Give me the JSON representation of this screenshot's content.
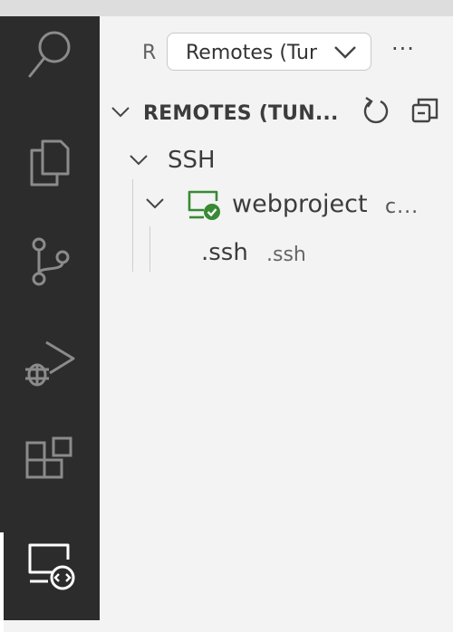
{
  "activity_bar": {
    "items": [
      {
        "icon": "search-icon"
      },
      {
        "icon": "files-icon"
      },
      {
        "icon": "source-control-icon"
      },
      {
        "icon": "run-debug-icon"
      },
      {
        "icon": "extensions-icon"
      },
      {
        "icon": "remote-explorer-icon",
        "active": true
      }
    ]
  },
  "sidebar": {
    "header_letter": "R",
    "dropdown_value": "Remotes (Tunnels/SSH)",
    "more_label": "···",
    "section": {
      "title": "REMOTES (TUN...",
      "refresh_icon": "refresh-icon",
      "collapse_icon": "collapse-all-icon"
    },
    "tree": {
      "group_label": "SSH",
      "host": {
        "label": "webproject",
        "description": "c...",
        "status_icon": "remote-connected-icon",
        "status_color": "#388a34"
      },
      "folder": {
        "label": ".ssh",
        "description": ".ssh"
      }
    }
  },
  "colors": {
    "activity_bg": "#2c2c2c",
    "sidebar_bg": "#f3f3f3",
    "accent_green": "#388a34"
  }
}
